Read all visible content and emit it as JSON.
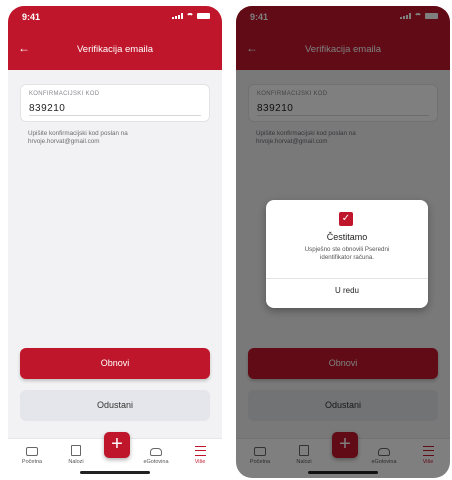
{
  "status": {
    "time": "9:41"
  },
  "screen": {
    "title": "Verifikacija emaila"
  },
  "code_field": {
    "label": "KONFIRMACIJSKI KOD",
    "value": "839210"
  },
  "hint_lines": [
    "Upišite konfirmacijski kod poslan na",
    "hrvoje.horvat@gmail.com"
  ],
  "buttons": {
    "renew": "Obnovi",
    "cancel": "Odustani"
  },
  "tabbar": {
    "items": [
      {
        "label": "Početna",
        "icon": "wallet-icon"
      },
      {
        "label": "Nalozi",
        "icon": "document-icon"
      },
      {
        "label": "eGotovina",
        "icon": "cash-icon"
      },
      {
        "label": "Više",
        "icon": "menu-icon"
      }
    ],
    "fab_symbol": "+"
  },
  "dialog": {
    "title": "Čestitamo",
    "message_lines": [
      "Uspješno ste obnovili Pseredni",
      "identifikator računa."
    ],
    "ok": "U redu"
  },
  "colors": {
    "brand": "#c0162b",
    "background": "#f2f2f4",
    "secondary_button": "#e5e6eb"
  }
}
